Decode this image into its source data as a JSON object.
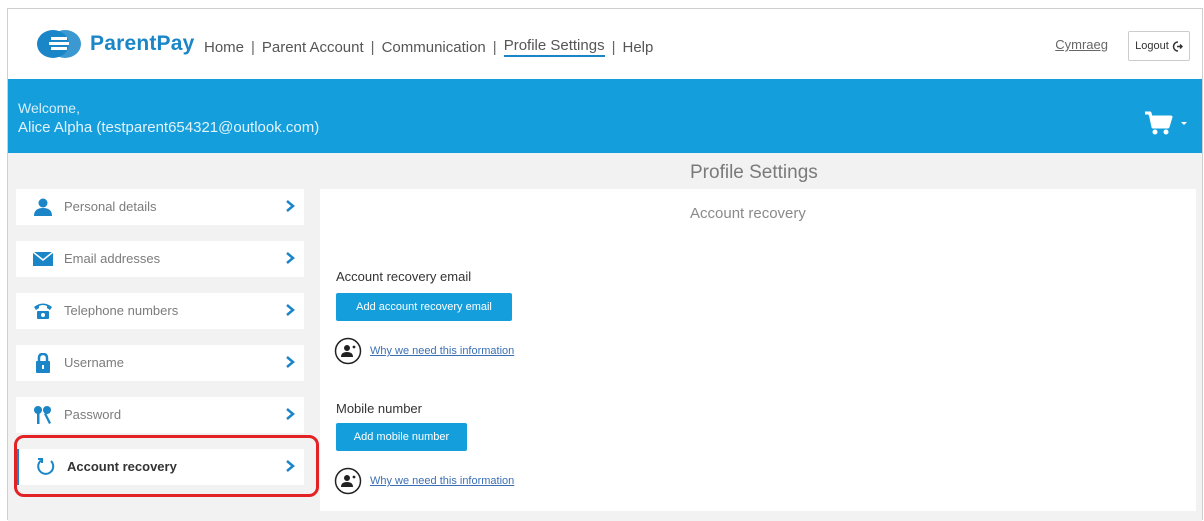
{
  "header": {
    "logo_text": "ParentPay",
    "nav": [
      {
        "label": "Home",
        "active": false
      },
      {
        "label": "Parent Account",
        "active": false
      },
      {
        "label": "Communication",
        "active": false
      },
      {
        "label": "Profile Settings",
        "active": true
      },
      {
        "label": "Help",
        "active": false
      }
    ],
    "separator": "|",
    "language_link": "Cymraeg",
    "logout_label": "Logout"
  },
  "banner": {
    "welcome": "Welcome,",
    "user": "Alice Alpha (testparent654321@outlook.com)",
    "cart_icon": "shopping-cart-icon"
  },
  "page_title": "Profile Settings",
  "sidebar": {
    "items": [
      {
        "label": "Personal details",
        "icon": "person-icon",
        "active": false
      },
      {
        "label": "Email addresses",
        "icon": "envelope-icon",
        "active": false
      },
      {
        "label": "Telephone numbers",
        "icon": "telephone-icon",
        "active": false
      },
      {
        "label": "Username",
        "icon": "lock-icon",
        "active": false
      },
      {
        "label": "Password",
        "icon": "keys-icon",
        "active": false
      },
      {
        "label": "Account recovery",
        "icon": "recovery-icon",
        "active": true
      }
    ]
  },
  "panel": {
    "title": "Account recovery",
    "email_label": "Account recovery email",
    "email_button": "Add account recovery email",
    "why_link_1": "Why we need this information",
    "mobile_label": "Mobile number",
    "mobile_button": "Add mobile number",
    "why_link_2": "Why we need this information"
  },
  "colors": {
    "brand_blue": "#149fdc",
    "highlight_red": "#e32226"
  }
}
